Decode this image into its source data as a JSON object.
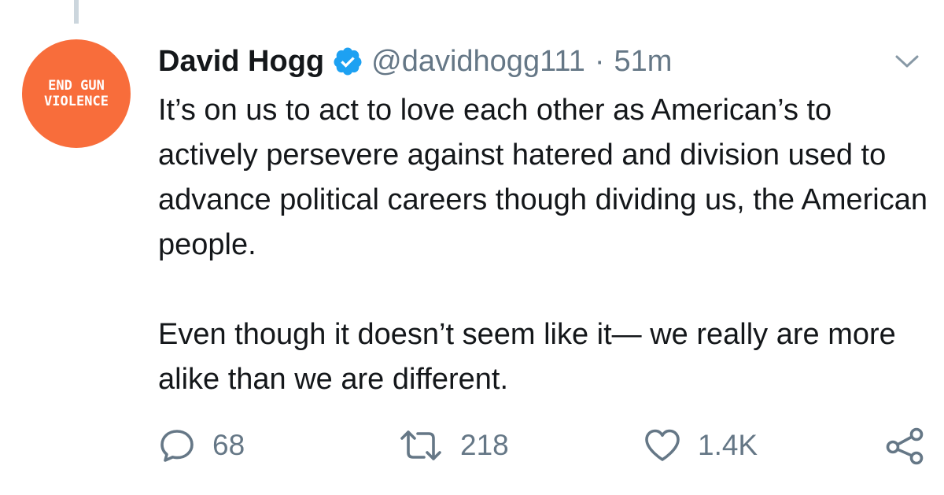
{
  "tweet": {
    "author": {
      "name": "David Hogg",
      "handle": "@davidhogg111",
      "verified": true,
      "avatar": {
        "line1": "END GUN",
        "line2": "VIOLENCE",
        "bg_color": "#f86d3b"
      }
    },
    "separator": "·",
    "time": "51m",
    "paragraphs": [
      "It’s on us to act to love each other as American’s to actively persevere against hatered and division used to advance political careers though dividing us, the American people.",
      "Even though it doesn’t seem like it— we really are more alike than we are different."
    ],
    "actions": {
      "reply": {
        "icon": "reply-icon",
        "count": "68"
      },
      "retweet": {
        "icon": "retweet-icon",
        "count": "218"
      },
      "like": {
        "icon": "heart-icon",
        "count": "1.4K"
      },
      "share": {
        "icon": "share-icon"
      }
    }
  },
  "colors": {
    "text": "#14171a",
    "secondary": "#657786",
    "verified_blue": "#1da1f2",
    "thread_line": "#ccd6dd"
  }
}
